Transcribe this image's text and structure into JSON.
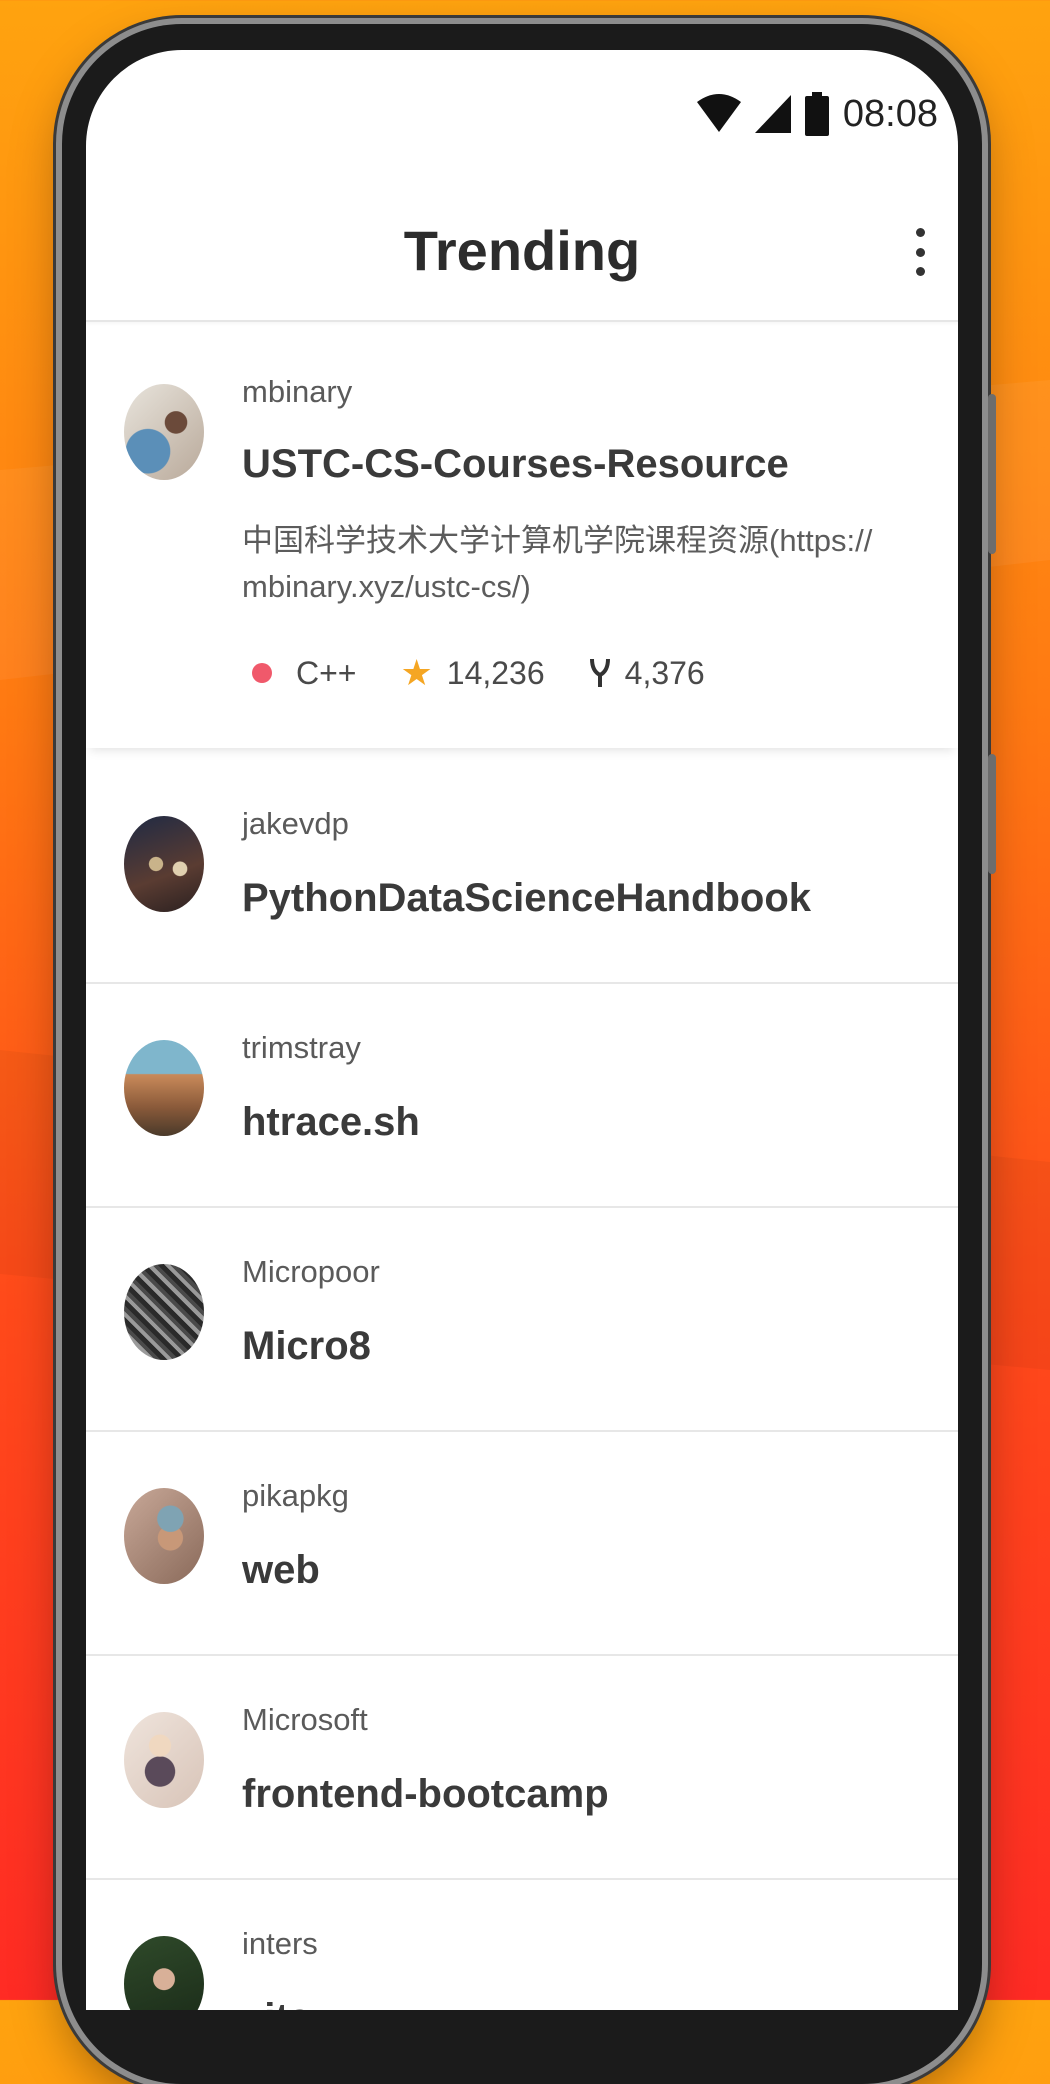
{
  "status_bar": {
    "time": "08:08"
  },
  "app_bar": {
    "title": "Trending"
  },
  "colors": {
    "accent": "#f5a623",
    "lang_cpp": "#f34b7d"
  },
  "repos": [
    {
      "owner": "mbinary",
      "name": "USTC-CS-Courses-Resource",
      "description": "中国科学技术大学计算机学院课程资源(https:// mbinary.xyz/ustc-cs/)",
      "language": "C++",
      "stars": "14,236",
      "forks": "4,376"
    },
    {
      "owner": "jakevdp",
      "name": "PythonDataScienceHandbook"
    },
    {
      "owner": "trimstray",
      "name": "htrace.sh"
    },
    {
      "owner": "Micropoor",
      "name": "Micro8"
    },
    {
      "owner": "pikapkg",
      "name": "web"
    },
    {
      "owner": "Microsoft",
      "name": "frontend-bootcamp"
    },
    {
      "owner": "inters",
      "name": "vita"
    }
  ]
}
